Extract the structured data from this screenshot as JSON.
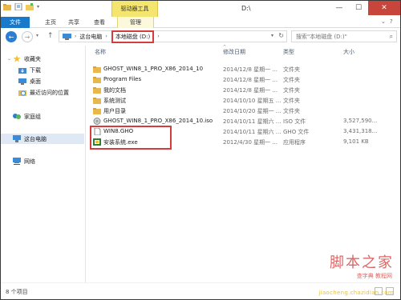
{
  "window": {
    "title": "D:\\",
    "context_tab_group": "驱动器工具",
    "controls": {
      "minimize": "—",
      "maximize": "☐",
      "close": "✕"
    }
  },
  "ribbon": {
    "tabs": [
      {
        "label": "文件",
        "active": true
      },
      {
        "label": "主页"
      },
      {
        "label": "共享"
      },
      {
        "label": "查看"
      },
      {
        "label": "管理"
      }
    ]
  },
  "navigation": {
    "back": "←",
    "forward": "→",
    "up": "↑",
    "breadcrumb": [
      "这台电脑",
      "本地磁盘 (D:)"
    ],
    "search_placeholder": "搜索\"本地磁盘 (D:)\""
  },
  "sidebar": {
    "items": [
      {
        "label": "收藏夹",
        "icon": "star-icon"
      },
      {
        "label": "下载",
        "icon": "download-folder-icon"
      },
      {
        "label": "桌面",
        "icon": "desktop-folder-icon"
      },
      {
        "label": "最近访问的位置",
        "icon": "recent-places-icon"
      },
      {
        "label": "家庭组",
        "icon": "homegroup-icon"
      },
      {
        "label": "这台电脑",
        "icon": "computer-icon",
        "selected": true
      },
      {
        "label": "网络",
        "icon": "network-icon"
      }
    ]
  },
  "columns": [
    "名称",
    "修改日期",
    "类型",
    "大小"
  ],
  "files": [
    {
      "name": "GHOST_WIN8_1_PRO_X86_2014_10",
      "modified": "2014/12/8 星期一 ...",
      "type": "文件夹",
      "size": "",
      "icon": "folder-icon"
    },
    {
      "name": "Program Files",
      "modified": "2014/12/8 星期一 ...",
      "type": "文件夹",
      "size": "",
      "icon": "folder-icon"
    },
    {
      "name": "我的文档",
      "modified": "2014/12/8 星期一 ...",
      "type": "文件夹",
      "size": "",
      "icon": "folder-icon"
    },
    {
      "name": "系统测试",
      "modified": "2014/10/10 星期五 ...",
      "type": "文件夹",
      "size": "",
      "icon": "folder-icon"
    },
    {
      "name": "用户目录",
      "modified": "2014/10/20 星期一 ...",
      "type": "文件夹",
      "size": "",
      "icon": "folder-icon"
    },
    {
      "name": "GHOST_WIN8_1_PRO_X86_2014_10.iso",
      "modified": "2014/10/11 星期六 ...",
      "type": "ISO 文件",
      "size": "3,527,590...",
      "icon": "iso-file-icon"
    },
    {
      "name": "WIN8.GHO",
      "modified": "2014/10/11 星期六 ...",
      "type": "GHO 文件",
      "size": "3,431,318...",
      "icon": "file-icon"
    },
    {
      "name": "安装系统.exe",
      "modified": "2012/4/30 星期一 ...",
      "type": "应用程序",
      "size": "9,101 KB",
      "icon": "installer-exe-icon"
    }
  ],
  "status": {
    "item_count": "8 个项目"
  },
  "watermark": {
    "main": "脚本之家",
    "sub": "查字典 教程网",
    "url": "jiaocheng.chazidian.com"
  },
  "colors": {
    "file_tab": "#1979ca",
    "context_group": "#f4e56f",
    "highlight_box": "#d63c3c",
    "folder": "#e8b84a",
    "close_button": "#c7453b"
  }
}
